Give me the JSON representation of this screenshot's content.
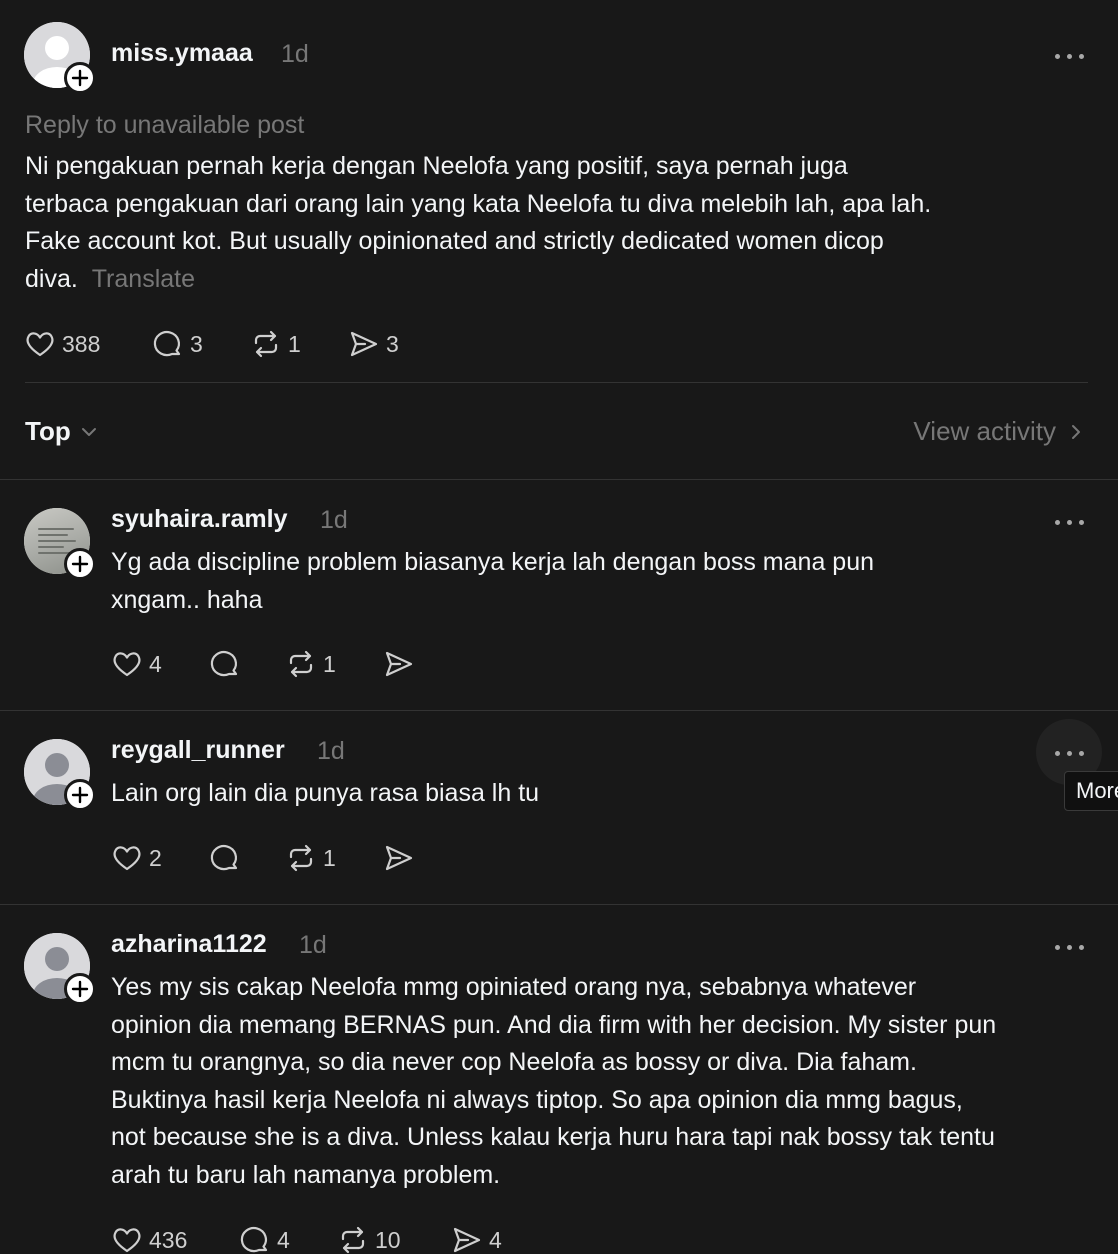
{
  "post": {
    "username": "miss.ymaaa",
    "time": "1d",
    "reply_context": "Reply to unavailable post",
    "lines": [
      "Ni pengakuan pernah kerja dengan Neelofa yang positif, saya pernah juga",
      "terbaca pengakuan dari orang lain yang kata Neelofa tu diva melebih lah, apa lah.",
      "Fake account kot. But usually opinionated and strictly dedicated women dicop",
      "diva."
    ],
    "translate_label": "Translate",
    "likes": "388",
    "replies": "3",
    "reposts": "1",
    "shares": "3"
  },
  "sort": {
    "label": "Top",
    "view_activity": "View activity"
  },
  "comments": [
    {
      "username": "syuhaira.ramly",
      "time": "1d",
      "lines": [
        "Yg ada discipline problem biasanya kerja lah dengan boss mana pun",
        "xngam.. haha"
      ],
      "likes": "4",
      "replies": "",
      "reposts": "1",
      "shares": ""
    },
    {
      "username": "reygall_runner",
      "time": "1d",
      "lines": [
        "Lain org lain dia punya rasa biasa lh tu"
      ],
      "likes": "2",
      "replies": "",
      "reposts": "1",
      "shares": ""
    },
    {
      "username": "azharina1122",
      "time": "1d",
      "lines": [
        "Yes my sis cakap Neelofa mmg opiniated orang nya, sebabnya whatever",
        "opinion dia memang BERNAS pun. And dia firm with her decision. My sister pun",
        "mcm tu orangnya, so dia never cop Neelofa as bossy or diva. Dia faham.",
        "Buktinya hasil kerja Neelofa ni always tiptop. So apa opinion dia mmg bagus,",
        "not because she is a diva. Unless kalau kerja huru hara tapi nak bossy tak tentu",
        "arah tu baru lah namanya problem."
      ],
      "likes": "436",
      "replies": "4",
      "reposts": "10",
      "shares": "4"
    }
  ],
  "tooltip": "More",
  "icons": {
    "like": "heart-icon",
    "reply": "comment-icon",
    "repost": "repost-icon",
    "share": "share-icon",
    "more": "more-icon",
    "follow": "plus-icon",
    "chevron": "chevron-down-icon",
    "arrow": "chevron-right-icon"
  },
  "colors": {
    "background": "#181818",
    "text": "#f3f5f7",
    "muted": "#777777",
    "divider": "#333333"
  }
}
